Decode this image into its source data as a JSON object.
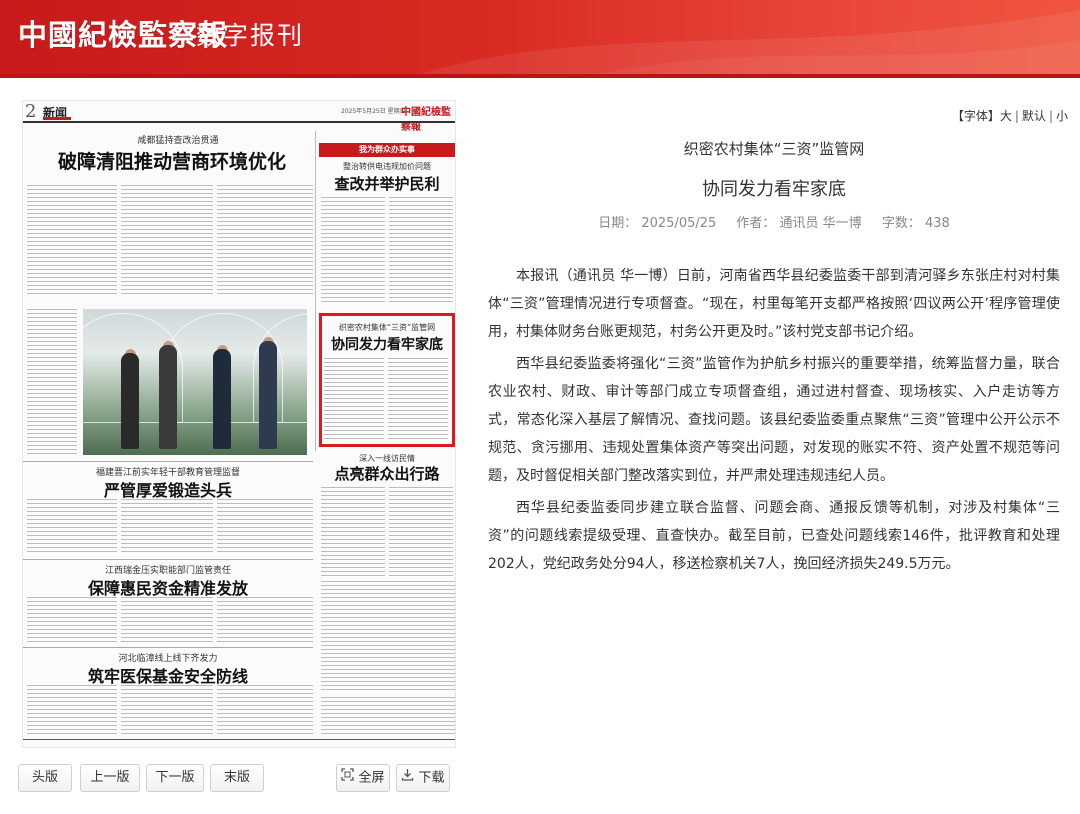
{
  "header": {
    "logo_text": "中國紀檢監察報",
    "subtitle": "数字报刊"
  },
  "newspaper": {
    "page_number": "2",
    "section_name": "新闻",
    "date_line": "2025年5月25日  星期日",
    "brand": "中國紀檢監察報",
    "stories": [
      {
        "kicker": "咸都猛持查改治贯通",
        "headline": "破障清阻推动营商环境优化"
      },
      {
        "kicker": "整治转供电违规加价问题",
        "headline": "查改并举护民利"
      },
      {
        "kicker": "织密农村集体“三资”监管网",
        "headline": "协同发力看牢家底"
      },
      {
        "kicker": "深入一线访民情",
        "headline": "点亮群众出行路"
      },
      {
        "kicker": "福建晋江前实年轻干部教育管理监督",
        "headline": "严管厚爱锻造头兵"
      },
      {
        "kicker": "江西瑞金压实职能部门监管责任",
        "headline": "保障惠民资金精准发放"
      },
      {
        "kicker": "河北临漳线上线下齐发力",
        "headline": "筑牢医保基金安全防线"
      }
    ],
    "column_label": "我为群众办实事"
  },
  "pager": {
    "first": "头版",
    "prev": "上一版",
    "next": "下一版",
    "last": "末版",
    "fullscreen": "全屏",
    "download": "下载"
  },
  "font_controls": {
    "label": "【字体】",
    "large": "大",
    "default": "默认",
    "small": "小"
  },
  "article": {
    "kicker": "织密农村集体“三资”监管网",
    "title": "协同发力看牢家底",
    "date": "日期： 2025/05/25",
    "author": "作者： 通讯员 华一博",
    "word_count": "字数： 438",
    "paragraphs": [
      "本报讯（通讯员 华一博）日前，河南省西华县纪委监委干部到清河驿乡东张庄村对村集体“三资”管理情况进行专项督查。“现在，村里每笔开支都严格按照‘四议两公开’程序管理使用，村集体财务台账更规范，村务公开更及时。”该村党支部书记介绍。",
      "西华县纪委监委将强化“三资”监管作为护航乡村振兴的重要举措，统筹监督力量，联合农业农村、财政、审计等部门成立专项督查组，通过进村督查、现场核实、入户走访等方式，常态化深入基层了解情况、查找问题。该县纪委监委重点聚焦“三资”管理中公开公示不规范、贪污挪用、违规处置集体资产等突出问题，对发现的账实不符、资产处置不规范等问题，及时督促相关部门整改落实到位，并严肃处理违规违纪人员。",
      "西华县纪委监委同步建立联合监督、问题会商、通报反馈等机制，对涉及村集体“三资”的问题线索提级受理、直查快办。截至目前，已查处问题线索146件，批评教育和处理202人，党纪政务处分94人，移送检察机关7人，挽回经济损失249.5万元。"
    ]
  },
  "colors": {
    "brand_red": "#c8191c",
    "highlight_red": "#e0191f"
  }
}
